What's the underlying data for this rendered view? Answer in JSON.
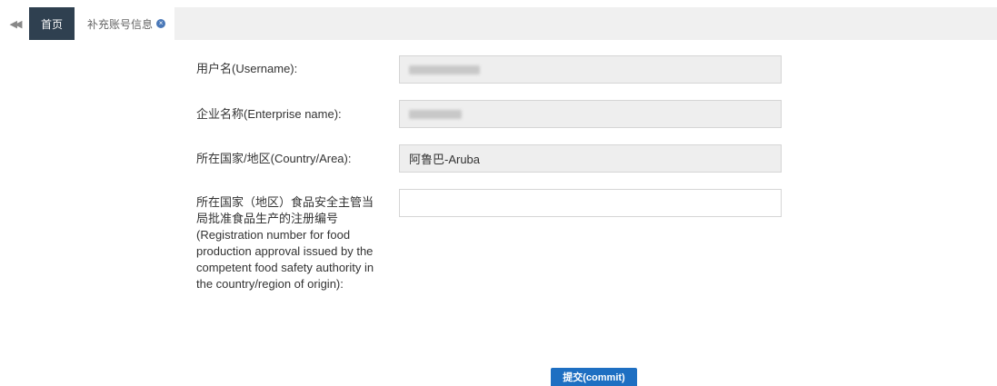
{
  "tabs": {
    "back_icon": "double-chevron-left-icon",
    "home_label": "首页",
    "current_label": "补充账号信息",
    "close_icon": "close-circle-icon",
    "close_glyph": "×"
  },
  "form": {
    "username": {
      "label": "用户名(Username):",
      "value": ""
    },
    "enterprise": {
      "label": "企业名称(Enterprise name):",
      "value": ""
    },
    "country": {
      "label": "所在国家/地区(Country/Area):",
      "value": "阿鲁巴-Aruba"
    },
    "registration": {
      "label": "所在国家（地区）食品安全主管当局批准食品生产的注册编号(Registration number for food production approval issued by the competent food safety authority in the country/region of origin):",
      "value": "",
      "placeholder": ""
    }
  },
  "submit": {
    "label": "提交(commit)"
  },
  "colors": {
    "home_tab_bg": "#2f4050",
    "tabbar_bg": "#f0f0f0",
    "readonly_bg": "#eeeeee",
    "submit_bg": "#1e6fc2",
    "close_icon": "#4a78b8"
  }
}
